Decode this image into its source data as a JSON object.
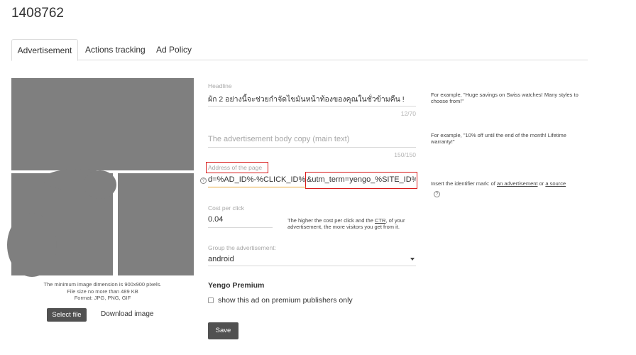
{
  "page": {
    "title": "1408762"
  },
  "tabs": [
    {
      "label": "Advertisement",
      "active": true
    },
    {
      "label": "Actions tracking",
      "active": false
    },
    {
      "label": "Ad Policy",
      "active": false
    }
  ],
  "image_panel": {
    "info_lines": [
      "The minimum image dimension is 900x900 pixels.",
      "File size no more than 489 KB",
      "Format: JPG, PNG, GIF"
    ],
    "select_label": "Select file",
    "download_label": "Download image"
  },
  "headline": {
    "label": "Headline",
    "value": "ผัก  2  อย่างนี้จะช่วยกำจัดไขมันหน้าท้องของคุณในชั่วข้ามคืน !",
    "counter": "12/70",
    "hint": "For example, \"Huge savings on Swiss watches! Many styles to choose from!\""
  },
  "body_copy": {
    "placeholder": "The advertisement body copy (main text)",
    "counter": "150/150",
    "hint": "For example, \"10% off until the end of the month! Lifetime warranty!\""
  },
  "address": {
    "label": "Address of the page",
    "value_left": "d=%AD_ID%-%CLICK_ID%",
    "value_right": "&utm_term=yengo_%SITE_ID%",
    "help": "?",
    "hint_prefix": "Insert the identifier mark: of ",
    "hint_link1": "an advertisement",
    "hint_or": " or ",
    "hint_link2": "a source"
  },
  "cpc": {
    "label": "Cost per click",
    "value": "0.04",
    "hint_prefix": "The higher the cost per click and the ",
    "hint_link": "CTR",
    "hint_suffix": ", of your advertisement, the more visitors you get from it."
  },
  "group": {
    "label": "Group the advertisement:",
    "value": "android"
  },
  "premium": {
    "title": "Yengo Premium",
    "checkbox_label": "show this ad on premium publishers only"
  },
  "save_label": "Save",
  "colors": {
    "button_bg": "#515151",
    "highlight": "#d91c1c",
    "image_placeholder": "#7f7f7f"
  }
}
